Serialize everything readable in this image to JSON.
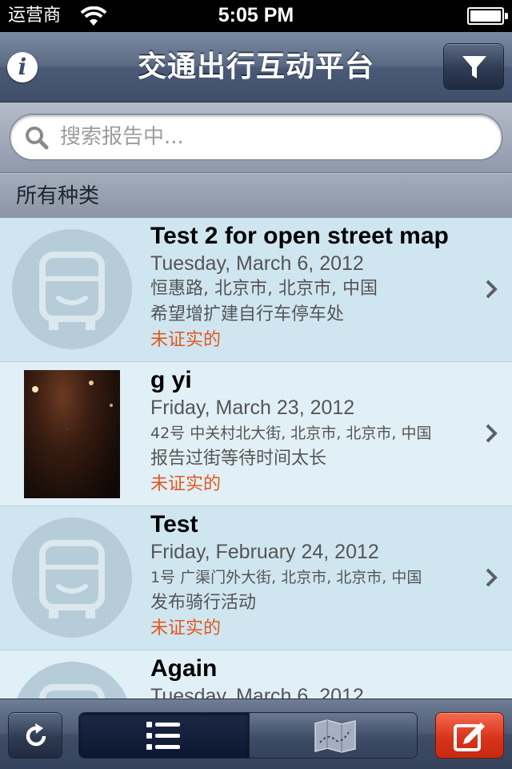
{
  "status_bar": {
    "carrier": "运营商",
    "time": "5:05 PM"
  },
  "nav": {
    "title": "交通出行互动平台",
    "info_icon": "info-icon",
    "filter_icon": "filter-funnel-icon"
  },
  "search": {
    "placeholder": "搜索报告中..."
  },
  "section": {
    "title": "所有种类"
  },
  "reports": [
    {
      "title": "Test 2 for open street map",
      "date": "Tuesday, March 6, 2012",
      "address": "恒惠路, 北京市, 北京市, 中国",
      "description": "希望增扩建自行车停车处",
      "status": "未证实的",
      "thumbnail": "bus-placeholder-icon"
    },
    {
      "title": "g yi",
      "date": "Friday, March 23, 2012",
      "address": "42号 中关村北大街, 北京市, 北京市, 中国",
      "description": "报告过街等待时间太长",
      "status": "未证实的",
      "thumbnail": "photo"
    },
    {
      "title": "Test",
      "date": "Friday, February 24, 2012",
      "address": "1号 广渠门外大街, 北京市, 北京市, 中国",
      "description": "发布骑行活动",
      "status": "未证实的",
      "thumbnail": "bus-placeholder-icon"
    },
    {
      "title": "Again",
      "date": "Tuesday, March 6, 2012",
      "address": "",
      "description": "",
      "status": "",
      "thumbnail": "bus-placeholder-icon"
    }
  ],
  "toolbar": {
    "refresh_icon": "refresh-icon",
    "list_view_icon": "list-view-icon",
    "map_view_icon": "map-view-icon",
    "compose_icon": "compose-report-icon",
    "selected_view": "list"
  },
  "colors": {
    "status_unverified": "#e2581e",
    "row_odd": "#cfe6f0",
    "row_even": "#e1f0f6",
    "compose_button": "#d9341a"
  }
}
